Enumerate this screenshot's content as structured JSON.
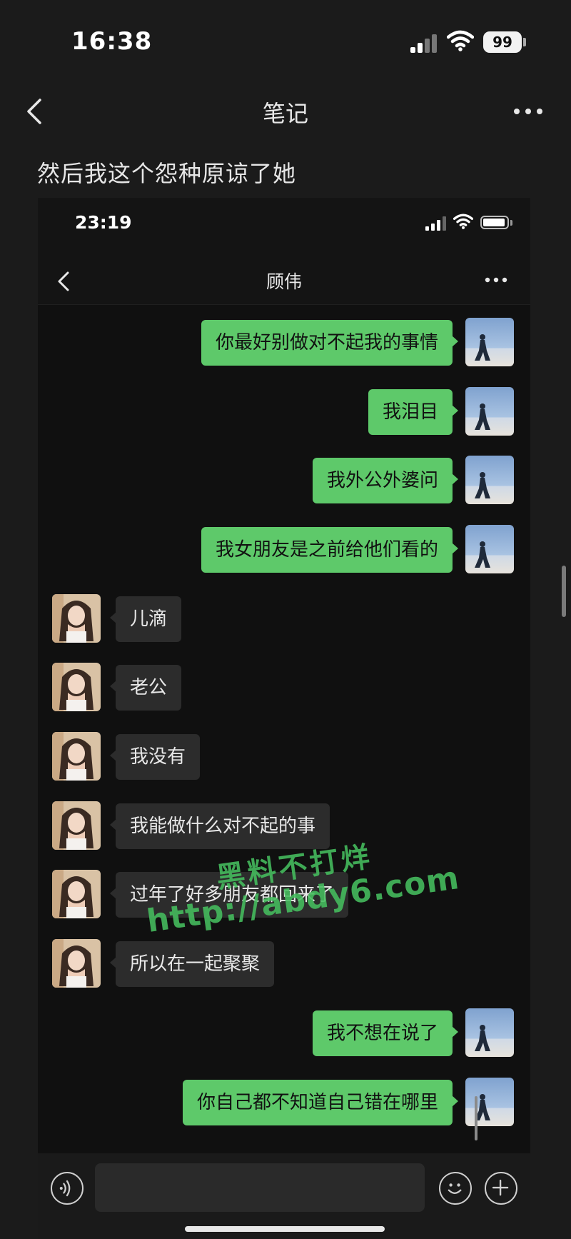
{
  "status_bar": {
    "time": "16:38",
    "battery": "99"
  },
  "nav": {
    "title": "笔记"
  },
  "note": {
    "caption": "然后我这个怨种原谅了她"
  },
  "screenshot": {
    "status_bar": {
      "time": "23:19"
    },
    "chat": {
      "title": "顾伟"
    },
    "messages": [
      {
        "side": "out",
        "text": "你最好别做对不起我的事情"
      },
      {
        "side": "out",
        "text": "我泪目"
      },
      {
        "side": "out",
        "text": "我外公外婆问"
      },
      {
        "side": "out",
        "text": "我女朋友是之前给他们看的"
      },
      {
        "side": "in",
        "text": "儿滴"
      },
      {
        "side": "in",
        "text": "老公"
      },
      {
        "side": "in",
        "text": "我没有"
      },
      {
        "side": "in",
        "text": "我能做什么对不起的事"
      },
      {
        "side": "in",
        "text": "过年了好多朋友都回来了"
      },
      {
        "side": "in",
        "text": "所以在一起聚聚"
      },
      {
        "side": "out",
        "text": "我不想在说了"
      },
      {
        "side": "out",
        "text": "你自己都不知道自己错在哪里"
      }
    ],
    "input": {
      "value": ""
    }
  },
  "watermark": {
    "line1": "黑料不打烊",
    "line2": "http://abdy6.com"
  },
  "icons": {
    "back": "chevron-left-icon",
    "more": "more-dots-icon",
    "voice": "voice-icon",
    "emoji": "emoji-icon",
    "plus": "plus-icon"
  },
  "colors": {
    "outgoing_bubble": "#5ec96a",
    "incoming_bubble": "#2c2c2c",
    "background": "#1b1b1b"
  }
}
